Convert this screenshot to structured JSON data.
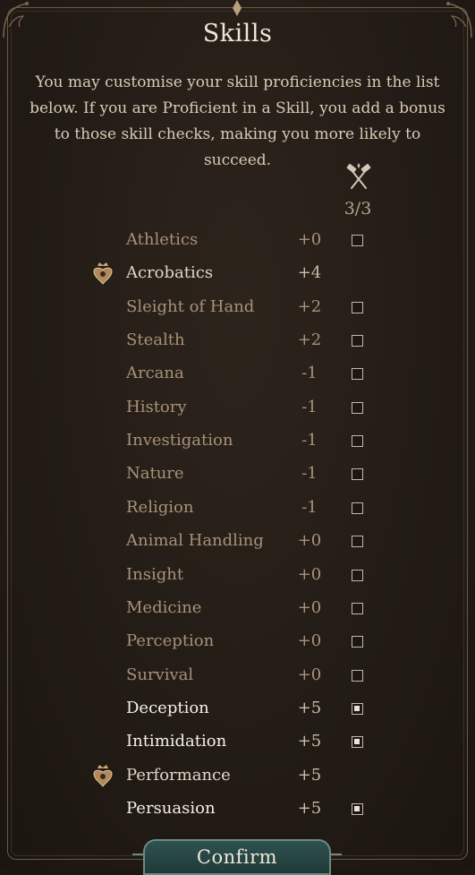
{
  "window": {
    "title": "Skills"
  },
  "description": "You may customise your skill proficiencies in the list below. If you are Proficient in a Skill, you add a bonus to those skill checks, making you more likely to succeed.",
  "proficiency": {
    "icon": "crossed-hammers-icon",
    "counter": "3/3"
  },
  "skills": [
    {
      "name": "Athletics",
      "modifier": "+0",
      "state": "unchecked"
    },
    {
      "name": "Acrobatics",
      "modifier": "+4",
      "state": "background"
    },
    {
      "name": "Sleight of Hand",
      "modifier": "+2",
      "state": "unchecked"
    },
    {
      "name": "Stealth",
      "modifier": "+2",
      "state": "unchecked"
    },
    {
      "name": "Arcana",
      "modifier": "-1",
      "state": "unchecked"
    },
    {
      "name": "History",
      "modifier": "-1",
      "state": "unchecked"
    },
    {
      "name": "Investigation",
      "modifier": "-1",
      "state": "unchecked"
    },
    {
      "name": "Nature",
      "modifier": "-1",
      "state": "unchecked"
    },
    {
      "name": "Religion",
      "modifier": "-1",
      "state": "unchecked"
    },
    {
      "name": "Animal Handling",
      "modifier": "+0",
      "state": "unchecked"
    },
    {
      "name": "Insight",
      "modifier": "+0",
      "state": "unchecked"
    },
    {
      "name": "Medicine",
      "modifier": "+0",
      "state": "unchecked"
    },
    {
      "name": "Perception",
      "modifier": "+0",
      "state": "unchecked"
    },
    {
      "name": "Survival",
      "modifier": "+0",
      "state": "unchecked"
    },
    {
      "name": "Deception",
      "modifier": "+5",
      "state": "checked"
    },
    {
      "name": "Intimidation",
      "modifier": "+5",
      "state": "checked"
    },
    {
      "name": "Performance",
      "modifier": "+5",
      "state": "background"
    },
    {
      "name": "Persuasion",
      "modifier": "+5",
      "state": "checked"
    }
  ],
  "confirm_label": "Confirm",
  "colors": {
    "accent_button": "#2e5250",
    "proficient_text": "#f4efe7",
    "dim_text": "#a8927a"
  }
}
